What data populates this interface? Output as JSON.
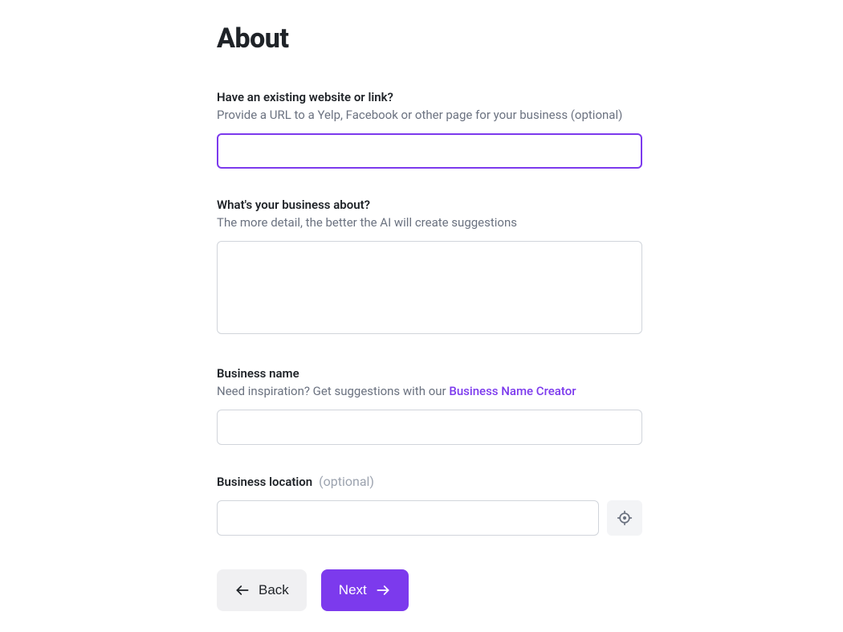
{
  "page": {
    "title": "About"
  },
  "website": {
    "label": "Have an existing website or link?",
    "help": "Provide a URL to a Yelp, Facebook or other page for your business (optional)",
    "value": ""
  },
  "about": {
    "label": "What's your business about?",
    "help": "The more detail, the better the AI will create suggestions",
    "value": ""
  },
  "business_name": {
    "label": "Business name",
    "help_prefix": "Need inspiration? Get suggestions with our ",
    "link_text": "Business Name Creator",
    "value": ""
  },
  "location": {
    "label": "Business location",
    "optional": "(optional)",
    "value": ""
  },
  "nav": {
    "back": "Back",
    "next": "Next"
  }
}
